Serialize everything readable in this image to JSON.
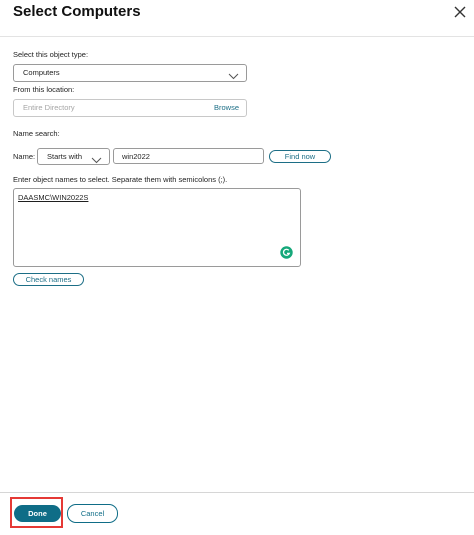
{
  "dialog": {
    "title": "Select Computers",
    "close_icon": "close-icon"
  },
  "object_type": {
    "label": "Select this object type:",
    "value": "Computers",
    "chevron_icon": "chevron-down-icon"
  },
  "location": {
    "label": "From this location:",
    "placeholder": "Entire Directory",
    "browse_label": "Browse"
  },
  "name_search": {
    "section_label": "Name search:",
    "name_label": "Name:",
    "match_mode": "Starts with",
    "query": "win2022",
    "find_label": "Find now"
  },
  "object_names": {
    "label": "Enter object names to select. Separate them with semicolons (;).",
    "entries": [
      "DAASMC\\WIN2022S"
    ],
    "grammarly_icon": "grammarly-icon"
  },
  "check_names_label": "Check names",
  "footer": {
    "done_label": "Done",
    "cancel_label": "Cancel"
  },
  "colors": {
    "accent": "#0f6d87",
    "highlight": "#e53935"
  }
}
